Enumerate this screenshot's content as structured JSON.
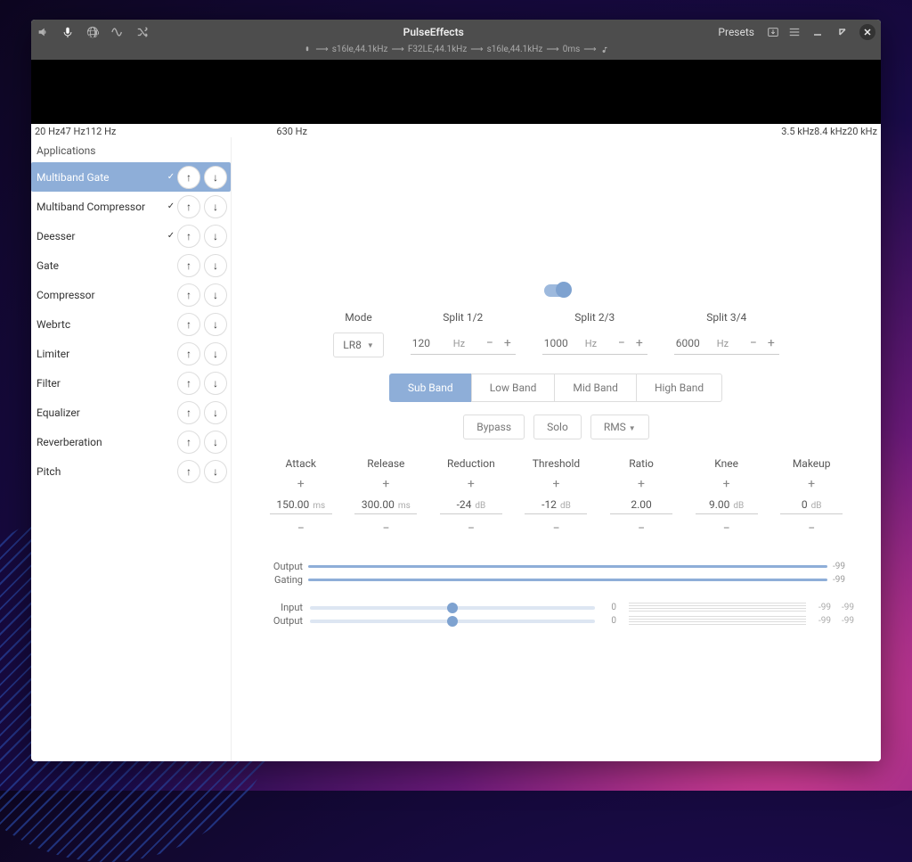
{
  "titlebar": {
    "title": "PulseEffects",
    "subtitle_parts": [
      "s16le,44.1kHz",
      "F32LE,44.1kHz",
      "s16le,44.1kHz",
      "0ms"
    ],
    "presets_label": "Presets"
  },
  "freq_labels": [
    "20 Hz",
    "47 Hz",
    "112 Hz",
    "630 Hz",
    "3.5 kHz",
    "8.4 kHz",
    "20 kHz"
  ],
  "sidebar": {
    "header": "Applications",
    "items": [
      {
        "label": "Multiband Gate",
        "checked": true,
        "selected": true
      },
      {
        "label": "Multiband Compressor",
        "checked": true,
        "selected": false
      },
      {
        "label": "Deesser",
        "checked": true,
        "selected": false
      },
      {
        "label": "Gate",
        "checked": false,
        "selected": false
      },
      {
        "label": "Compressor",
        "checked": false,
        "selected": false
      },
      {
        "label": "Webrtc",
        "checked": false,
        "selected": false
      },
      {
        "label": "Limiter",
        "checked": false,
        "selected": false
      },
      {
        "label": "Filter",
        "checked": false,
        "selected": false
      },
      {
        "label": "Equalizer",
        "checked": false,
        "selected": false
      },
      {
        "label": "Reverberation",
        "checked": false,
        "selected": false
      },
      {
        "label": "Pitch",
        "checked": false,
        "selected": false
      }
    ]
  },
  "mode": {
    "label": "Mode",
    "value": "LR8"
  },
  "splits": [
    {
      "label": "Split 1/2",
      "value": "120",
      "unit": "Hz"
    },
    {
      "label": "Split 2/3",
      "value": "1000",
      "unit": "Hz"
    },
    {
      "label": "Split 3/4",
      "value": "6000",
      "unit": "Hz"
    }
  ],
  "band_tabs": [
    "Sub Band",
    "Low Band",
    "Mid Band",
    "High Band"
  ],
  "controls": {
    "bypass": "Bypass",
    "solo": "Solo",
    "detection": "RMS"
  },
  "params": [
    {
      "label": "Attack",
      "value": "150.00",
      "unit": "ms"
    },
    {
      "label": "Release",
      "value": "300.00",
      "unit": "ms"
    },
    {
      "label": "Reduction",
      "value": "-24",
      "unit": "dB"
    },
    {
      "label": "Threshold",
      "value": "-12",
      "unit": "dB"
    },
    {
      "label": "Ratio",
      "value": "2.00",
      "unit": ""
    },
    {
      "label": "Knee",
      "value": "9.00",
      "unit": "dB"
    },
    {
      "label": "Makeup",
      "value": "0",
      "unit": "dB"
    }
  ],
  "meters": {
    "output_label": "Output",
    "output_val": "-99",
    "gating_label": "Gating",
    "gating_val": "-99"
  },
  "io": {
    "input_label": "Input",
    "input_val": "0",
    "input_r1": "-99",
    "input_r2": "-99",
    "output_label": "Output",
    "output_val": "0",
    "output_r1": "-99",
    "output_r2": "-99"
  }
}
